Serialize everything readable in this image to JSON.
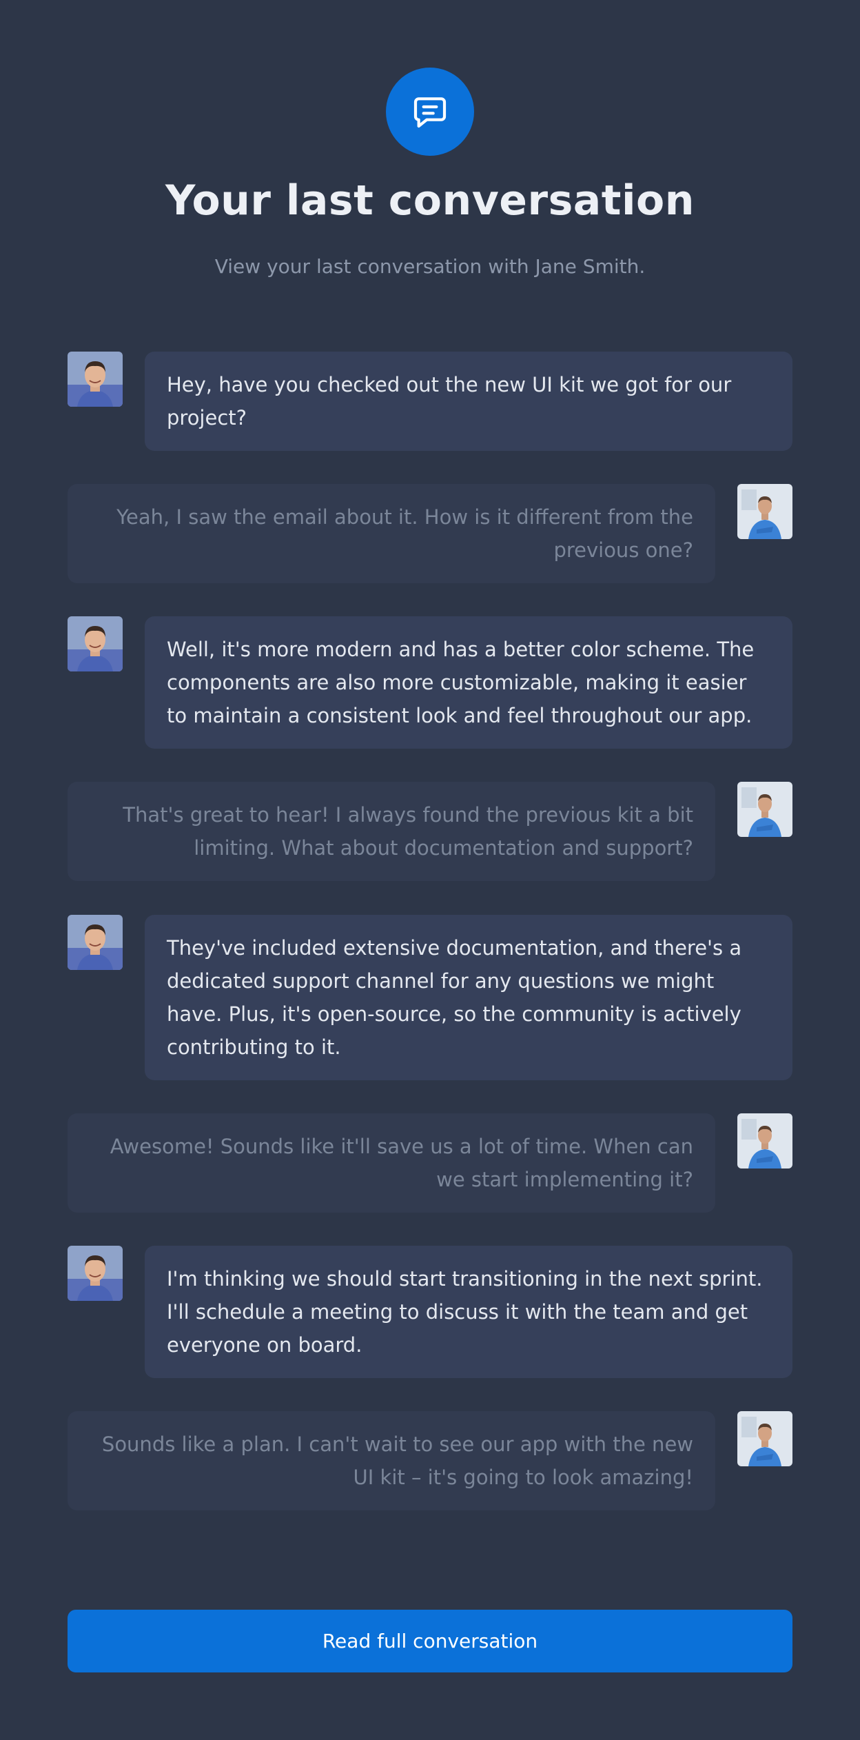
{
  "header": {
    "icon": "message-icon",
    "title": "Your last conversation",
    "subtitle": "View your last conversation with Jane Smith."
  },
  "messages": [
    {
      "side": "left",
      "avatar": "avatar-smiling-man",
      "text": "Hey, have you checked out the new UI kit we got for our project?"
    },
    {
      "side": "right",
      "avatar": "avatar-man-blue-shirt",
      "text": "Yeah, I saw the email about it. How is it different from the previous one?"
    },
    {
      "side": "left",
      "avatar": "avatar-smiling-man",
      "text": "Well, it's more modern and has a better color scheme. The components are also more customizable, making it easier to maintain a consistent look and feel throughout our app."
    },
    {
      "side": "right",
      "avatar": "avatar-man-blue-shirt",
      "text": "That's great to hear! I always found the previous kit a bit limiting. What about documentation and support?"
    },
    {
      "side": "left",
      "avatar": "avatar-smiling-man",
      "text": "They've included extensive documentation, and there's a dedicated support channel for any questions we might have. Plus, it's open-source, so the community is actively contributing to it."
    },
    {
      "side": "right",
      "avatar": "avatar-man-blue-shirt",
      "text": "Awesome! Sounds like it'll save us a lot of time. When can we start implementing it?"
    },
    {
      "side": "left",
      "avatar": "avatar-smiling-man",
      "text": "I'm thinking we should start transitioning in the next sprint. I'll schedule a meeting to discuss it with the team and get everyone on board."
    },
    {
      "side": "right",
      "avatar": "avatar-man-blue-shirt",
      "text": "Sounds like a plan. I can't wait to see our app with the new UI kit – it's going to look amazing!"
    }
  ],
  "cta": {
    "label": "Read full conversation"
  },
  "colors": {
    "background": "#2d3648",
    "accent": "#0b71d9",
    "bubble_sent": "#36405a",
    "bubble_received": "#323b50"
  }
}
